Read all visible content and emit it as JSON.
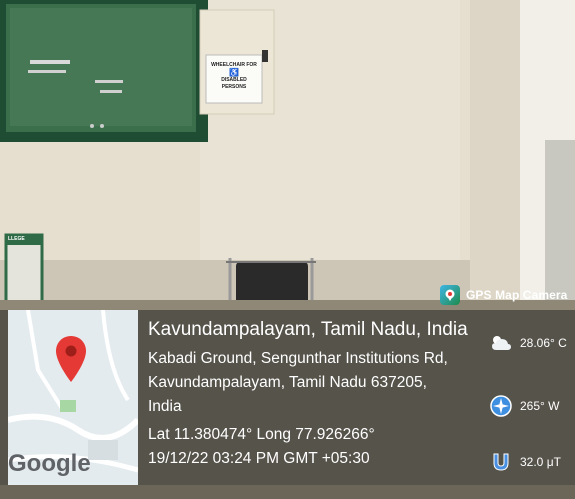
{
  "sign": {
    "line1": "WHEELCHAIR FOR",
    "line2": "DISABLED",
    "line3": "PERSONS"
  },
  "board_label": "LLEGE",
  "brand": {
    "name": "GPS Map Camera",
    "icon": "gps-map-camera-app-icon"
  },
  "map": {
    "logo": "Google",
    "pin_color": "#e53935",
    "icon": "location-pin-icon"
  },
  "location": {
    "title": "Kavundampalayam, Tamil Nadu, India",
    "address_line1": "Kabadi Ground, Sengunthar Institutions Rd,",
    "address_line2": "Kavundampalayam, Tamil Nadu 637205,",
    "address_line3": "India",
    "coordinates": "Lat 11.380474° Long 77.926266°",
    "datetime": "19/12/22 03:24 PM GMT +05:30"
  },
  "weather": {
    "temperature": "28.06° C",
    "temperature_icon": "partly-cloudy-icon",
    "wind": "265° W",
    "wind_icon": "compass-icon",
    "magnetic": "32.0 μT",
    "magnetic_icon": "magnet-icon"
  }
}
